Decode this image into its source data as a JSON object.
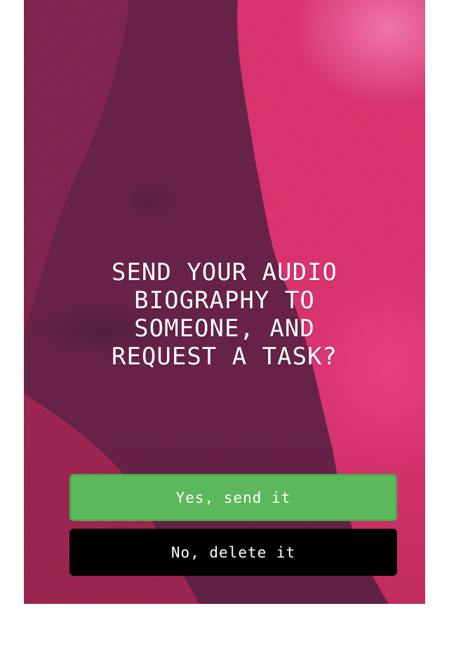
{
  "dialog": {
    "question": "SEND YOUR AUDIO BIOGRAPHY TO SOMEONE, AND REQUEST A TASK?",
    "confirm_label": "Yes, send it",
    "decline_label": "No, delete it"
  },
  "colors": {
    "confirm_button": "#5cb85c",
    "decline_button": "#000000",
    "background_accent": "#d8336e"
  }
}
